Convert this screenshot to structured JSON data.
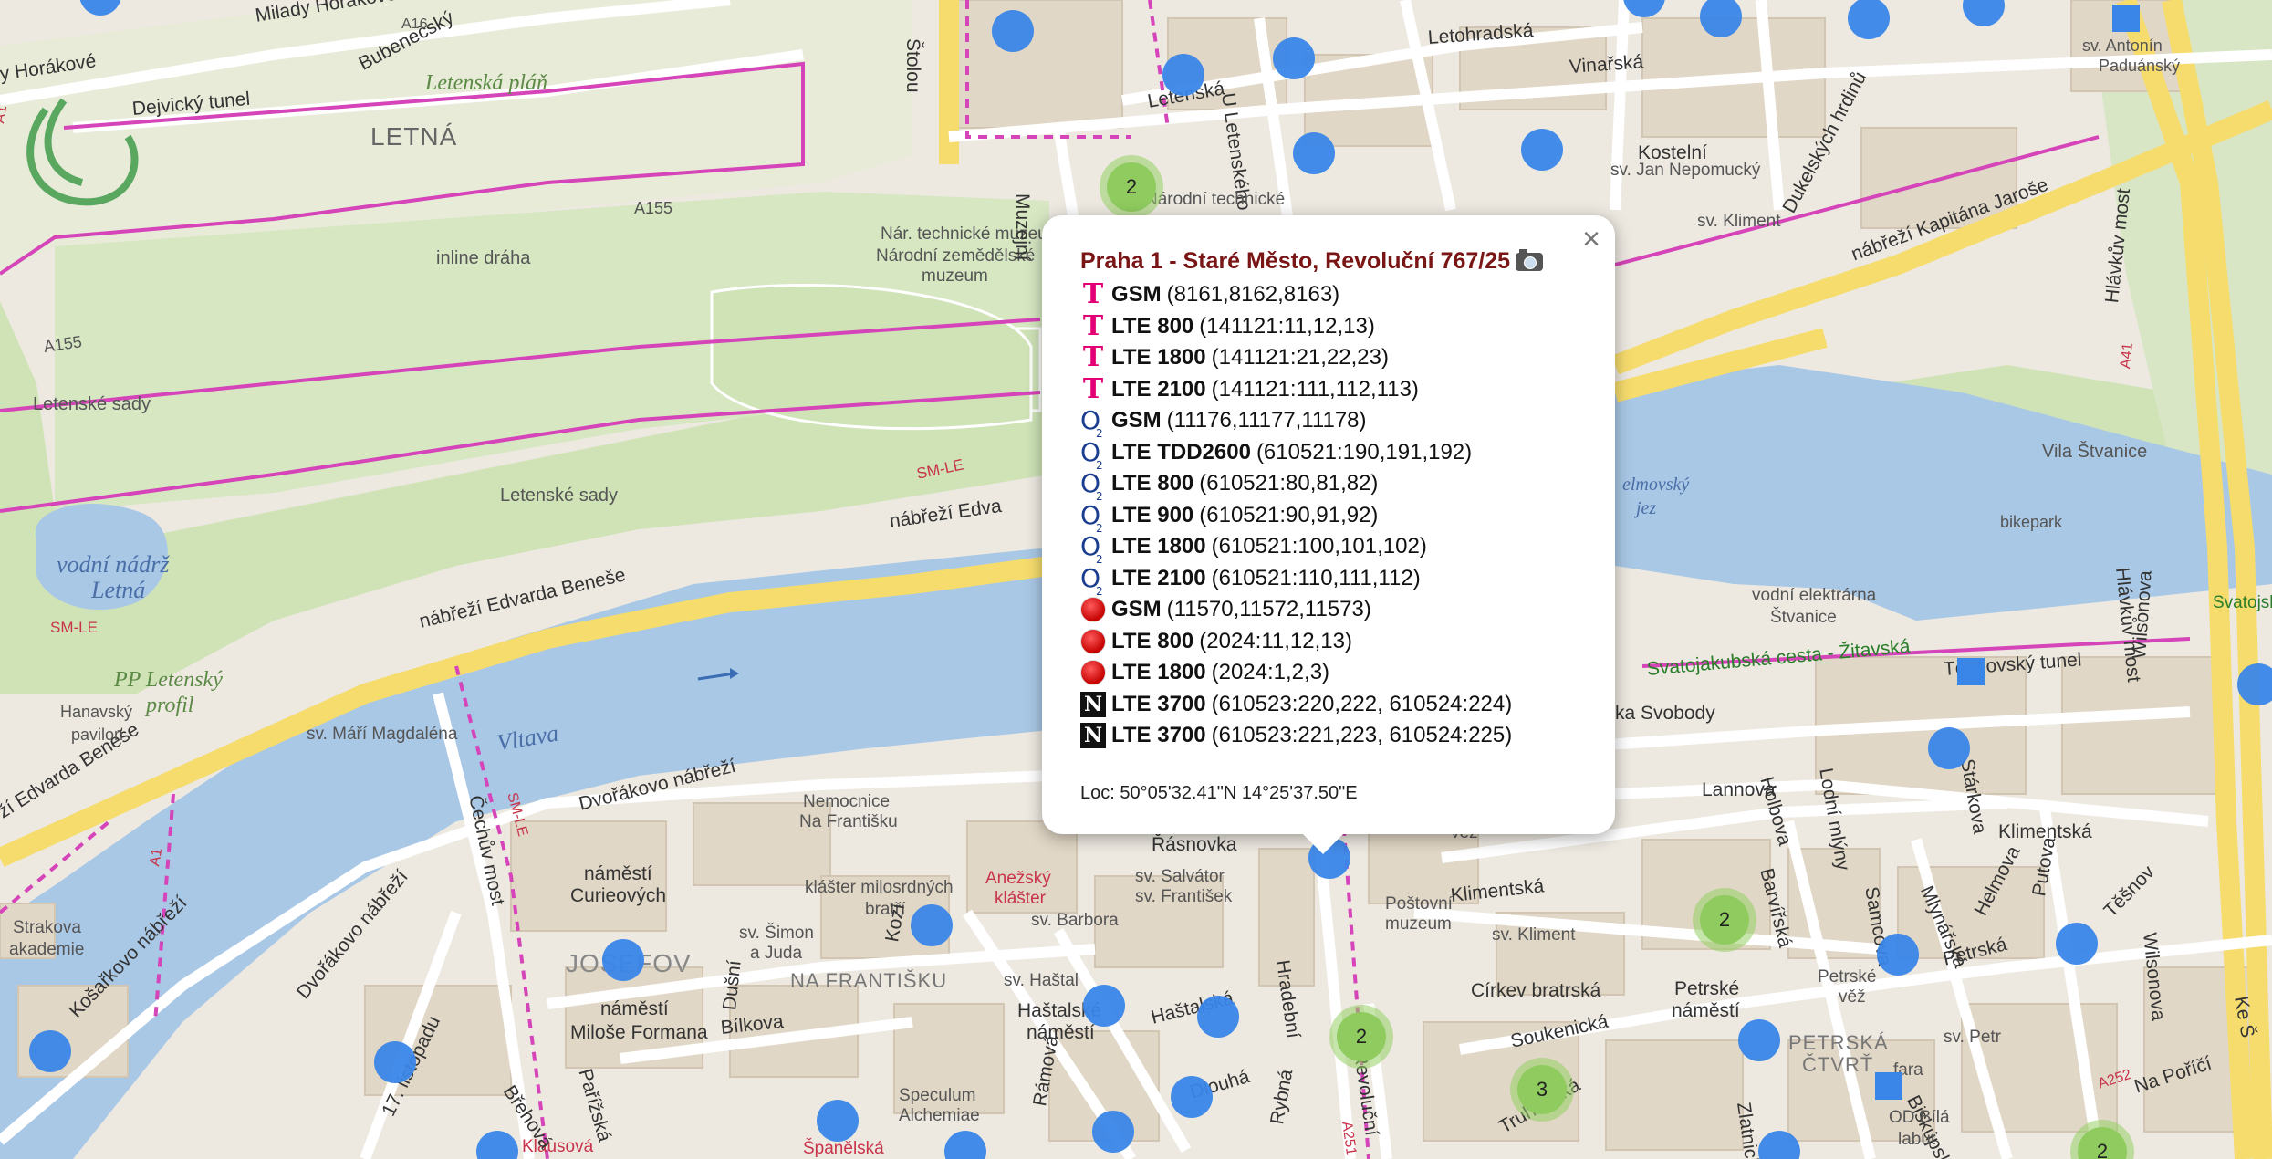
{
  "map": {
    "labels": {
      "milady_horakove": "Milady Horákové",
      "horakove": "y Horákové",
      "bubenecsky": "Bubenečský",
      "dejvicky": "Dejvický tunel",
      "letenska_plan": "Letenská pláň",
      "letna": "LETNÁ",
      "a16": "A16",
      "a155a": "A155",
      "a155b": "A155",
      "inline": "inline dráha",
      "letenske_sady": "Letenské sady",
      "letenske_sady2": "Letenské sady",
      "vodni_nadrz": "vodní nádrž",
      "letna_water": "Letná",
      "smle_a": "SM-LE",
      "smle_b": "SM-LE",
      "smle_c": "SM-LE",
      "nabrezi_eb": "nábřeží Edvarda Beneše",
      "nabrezi_ed": "nábřeží Edva",
      "nabrezi_eb2": "ží Edvarda Beneše",
      "pp_letensky": "PP Letenský",
      "profil": "profil",
      "hanavsky": "Hanavský",
      "pavilon": "pavilon",
      "sv_mari": "sv. Máří Magdaléna",
      "vltava": "Vltava",
      "cechuv": "Čechův most",
      "na_stolou": "Štolou",
      "letenska1": "Letenská",
      "u_letenskeho": "U Letenského sadu",
      "letohradska": "Letohradská",
      "vinarska": "Vinařská",
      "kostelni": "Kostelní",
      "sv_jan": "sv. Jan Nepomucký",
      "sv_kliment_top": "sv. Kliment",
      "dukelskych": "Dukelských hrdinů",
      "nabrezi_kj": "nábřeží Kapitána Jaroše",
      "narodni_tech": "Národní technické",
      "nar_tech_muz": "Nár. technické muzeum",
      "narodni_zem": "Národní zemědělské",
      "muzeum": "muzeum",
      "muzejni": "Muzejní",
      "sv_antonin": "sv. Antonín",
      "paduansky": "Paduánský",
      "hlavkuv": "Hlávkův most",
      "hlavkuv2": "Hlávkův most",
      "vila_stvanice": "Vila Štvanice",
      "bikepark": "bikepark",
      "helmovsky": "elmovský",
      "jez": "jez",
      "vodni_el": "vodní elektrárna",
      "stvanice": "Štvanice",
      "svatojakubska": "Svatojakubská cesta - Žitavská",
      "tesnovsky": "Těšnovský tunel",
      "svatojsk": "Svatojsk",
      "a41": "A41",
      "svobody": "ka Svobody",
      "lannova": "Lannova",
      "klimentska_e": "Klimentská",
      "holbova": "Holbova",
      "lodni_mlyny": "Lodní mlýny",
      "starkova": "Stárkova",
      "barvirska": "Barvířská",
      "samcova": "Samcova",
      "mlynarska": "Mlynářská",
      "helmova": "Helmova",
      "petrska": "Petrská",
      "putova": "Putova",
      "tesnov": "Těšnov",
      "wilsonova": "Wilsonova",
      "wilsonova2": "Wilsonova",
      "dvorakovo": "Dvořákovo nábřeží",
      "dvorakovo2": "Dvořákovo nábřeží",
      "nemocnice": "Nemocnice",
      "na_frantisku_h": "Na Františku",
      "rasnovka": "Řásnovka",
      "namesti_c": "náměstí",
      "curieovych": "Curieových",
      "klaster": "klášter milosrdných",
      "bratri": "bratří",
      "anezsky": "Anežský",
      "klaster2": "klášter",
      "sv_salvator": "sv. Salvátor",
      "sv_frantisek": "sv. František",
      "sv_barbora": "sv. Barbora",
      "sv_simon": "sv. Šimon",
      "a_juda": "a Juda",
      "josefov": "JOSEFOV",
      "na_frantisku": "NA FRANTIŠKU",
      "namesti_mf": "náměstí",
      "milose": "Miloše Formana",
      "bilkova": "Bílkova",
      "kozi": "Kozí",
      "dusni": "Dušní",
      "sv_hastal": "sv. Haštal",
      "hastalske": "Haštalské",
      "namesti_h": "náměstí",
      "hastalska": "Haštalská",
      "hradebni": "Hradební",
      "revolucni": "Revoluční",
      "a251": "A251",
      "postovni": "Poštovní",
      "muzeum2": "muzeum",
      "klimentska_w": "Klimentská",
      "sv_kliment": "sv. Kliment",
      "vez": "věž",
      "cirkev": "Církev bratrská",
      "soukenicka": "Soukenická",
      "petrske": "Petrské",
      "namesti_p": "náměstí",
      "petrske_vez": "Petrské",
      "vez2": "věž",
      "petrska_ctvrt": "PETRSKÁ",
      "ctvrt": "ČTVRŤ",
      "sv_petr": "sv. Petr",
      "fara": "fara",
      "biskupska": "Biskupská",
      "na_porici": "Na Poříčí",
      "a252": "A252",
      "od_bila": "OD Bílá",
      "labut": "labuť",
      "zlatnicka": "Zlatnická",
      "truhlarska": "Truhlářská",
      "rybna": "Rybná",
      "ramova": "Rámová",
      "dlouha": "Dlouhá",
      "speculum": "Speculum",
      "alchemiae": "Alchemiae",
      "spanelska": "Španělská",
      "klausova": "Klausová",
      "brehova": "Břehová",
      "parizska": "Pařížská",
      "17_listopadu": "17. listopadu",
      "kosarkovo": "Košařkovo nábřeží",
      "strakova": "Strakova",
      "akademie": "akademie",
      "a1": "A1",
      "a1b": "A1",
      "kf": "Ke Š"
    },
    "clusters": [
      "2",
      "2",
      "2",
      "3",
      "2"
    ]
  },
  "popup": {
    "title": "Praha 1 - Staré Město, Revoluční 767/25",
    "close": "×",
    "rows": [
      {
        "op": "t",
        "tech": "GSM",
        "ids": "(8161,8162,8163)"
      },
      {
        "op": "t",
        "tech": "LTE 800",
        "ids": "(141121:11,12,13)"
      },
      {
        "op": "t",
        "tech": "LTE 1800",
        "ids": "(141121:21,22,23)"
      },
      {
        "op": "t",
        "tech": "LTE 2100",
        "ids": "(141121:111,112,113)"
      },
      {
        "op": "o2",
        "tech": "GSM",
        "ids": "(11176,11177,11178)"
      },
      {
        "op": "o2",
        "tech": "LTE TDD2600",
        "ids": "(610521:190,191,192)"
      },
      {
        "op": "o2",
        "tech": "LTE 800",
        "ids": "(610521:80,81,82)"
      },
      {
        "op": "o2",
        "tech": "LTE 900",
        "ids": "(610521:90,91,92)"
      },
      {
        "op": "o2",
        "tech": "LTE 1800",
        "ids": "(610521:100,101,102)"
      },
      {
        "op": "o2",
        "tech": "LTE 2100",
        "ids": "(610521:110,111,112)"
      },
      {
        "op": "v",
        "tech": "GSM",
        "ids": "(11570,11572,11573)"
      },
      {
        "op": "v",
        "tech": "LTE 800",
        "ids": "(2024:11,12,13)"
      },
      {
        "op": "v",
        "tech": "LTE 1800",
        "ids": "(2024:1,2,3)"
      },
      {
        "op": "n",
        "tech": "LTE 3700",
        "ids": "(610523:220,222, 610524:224)"
      },
      {
        "op": "n",
        "tech": "LTE 3700",
        "ids": "(610523:221,223, 610524:225)"
      }
    ],
    "operator_icons": {
      "t": "T",
      "o2": "O",
      "o2sub": "2",
      "n": "N"
    },
    "loc": "Loc: 50°05'32.41\"N 14°25'37.50\"E"
  }
}
